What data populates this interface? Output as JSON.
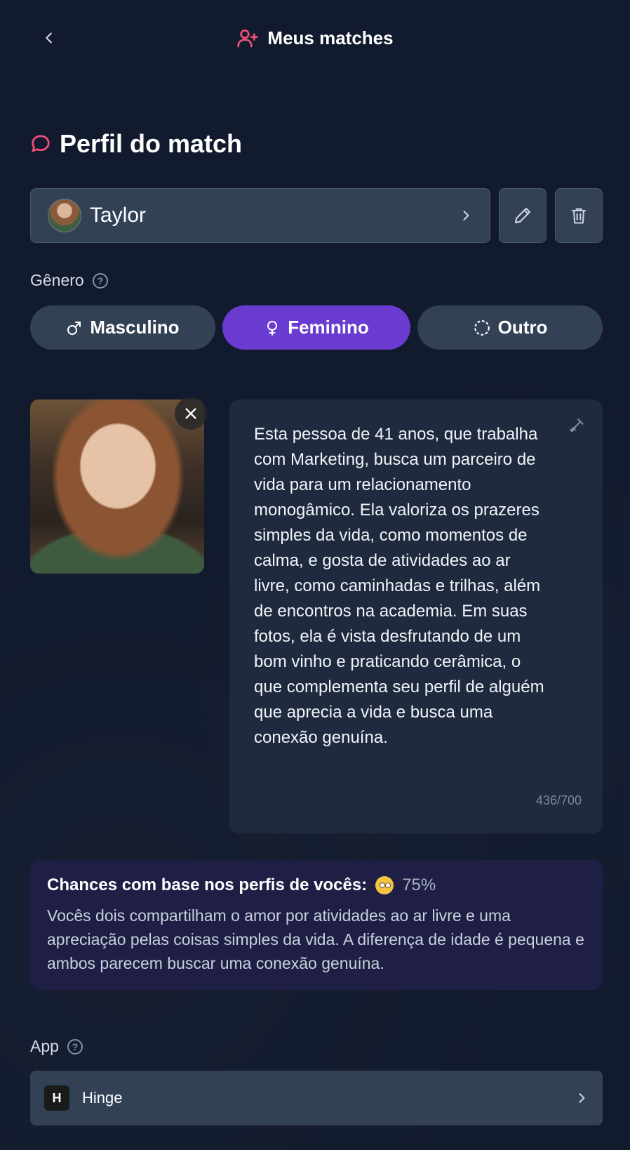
{
  "header": {
    "title": "Meus matches"
  },
  "section": {
    "title": "Perfil do match"
  },
  "person": {
    "name": "Taylor"
  },
  "gender": {
    "label": "Gênero",
    "options": [
      "Masculino",
      "Feminino",
      "Outro"
    ],
    "selected": "Feminino"
  },
  "description": {
    "text": "Esta pessoa de 41 anos, que trabalha com Marketing, busca um parceiro de vida para um relacionamento monogâmico. Ela valoriza os prazeres simples da vida, como momentos de calma, e gosta de atividades ao ar livre, como caminhadas e trilhas, além de encontros na academia. Em suas fotos, ela é vista desfrutando de um bom vinho e praticando cerâmica, o que complementa seu perfil de alguém que aprecia a vida e busca uma conexão genuína.",
    "counter": "436/700"
  },
  "chances": {
    "title": "Chances com base nos perfis de vocês:",
    "percent": "75%",
    "body": "Vocês dois compartilham o amor por atividades ao ar livre e uma apreciação pelas coisas simples da vida. A diferença de idade é pequena e ambos parecem buscar uma conexão genuína."
  },
  "app": {
    "label": "App",
    "name": "Hinge",
    "logo": "H"
  },
  "colors": {
    "accent": "#6a3bd1",
    "pink": "#f0507a",
    "background": "#121a2d"
  }
}
